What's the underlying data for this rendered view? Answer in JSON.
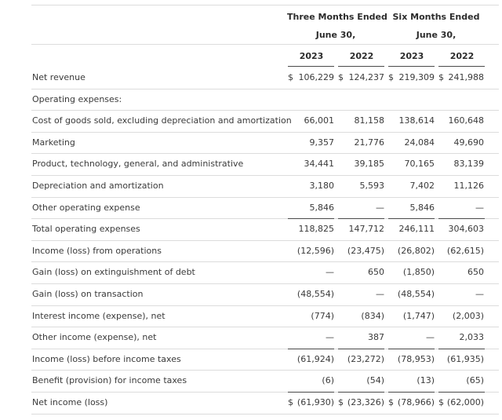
{
  "header": {
    "three_months": "Three Months Ended",
    "three_months_sub": "June 30,",
    "six_months": "Six Months Ended",
    "six_months_sub": "June 30,",
    "years": [
      "2023",
      "2022",
      "2023",
      "2022"
    ]
  },
  "rows": [
    {
      "label": "Net revenue",
      "values": [
        "106,229",
        "124,237",
        "219,309",
        "241,988"
      ],
      "dollars": [
        "$",
        "$",
        "$",
        "$"
      ]
    },
    {
      "label": "Operating expenses:",
      "values": [
        "",
        "",
        "",
        ""
      ],
      "dollars": [
        "",
        "",
        "",
        ""
      ]
    },
    {
      "label": "Cost of goods sold, excluding depreciation and amortization",
      "values": [
        "66,001",
        "81,158",
        "138,614",
        "160,648"
      ],
      "dollars": [
        "",
        "",
        "",
        ""
      ]
    },
    {
      "label": "Marketing",
      "values": [
        "9,357",
        "21,776",
        "24,084",
        "49,690"
      ],
      "dollars": [
        "",
        "",
        "",
        ""
      ]
    },
    {
      "label": "Product, technology, general, and administrative",
      "values": [
        "34,441",
        "39,185",
        "70,165",
        "83,139"
      ],
      "dollars": [
        "",
        "",
        "",
        ""
      ]
    },
    {
      "label": "Depreciation and amortization",
      "values": [
        "3,180",
        "5,593",
        "7,402",
        "11,126"
      ],
      "dollars": [
        "",
        "",
        "",
        ""
      ]
    },
    {
      "label": "Other operating expense",
      "values": [
        "5,846",
        "—",
        "5,846",
        "—"
      ],
      "dollars": [
        "",
        "",
        "",
        ""
      ]
    },
    {
      "label": "Total operating expenses",
      "values": [
        "118,825",
        "147,712",
        "246,111",
        "304,603"
      ],
      "dollars": [
        "",
        "",
        "",
        ""
      ]
    },
    {
      "label": "Income (loss) from operations",
      "values": [
        "(12,596)",
        "(23,475)",
        "(26,802)",
        "(62,615)"
      ],
      "dollars": [
        "",
        "",
        "",
        ""
      ]
    },
    {
      "label": "Gain (loss) on extinguishment of debt",
      "values": [
        "—",
        "650",
        "(1,850)",
        "650"
      ],
      "dollars": [
        "",
        "",
        "",
        ""
      ]
    },
    {
      "label": "Gain (loss) on transaction",
      "values": [
        "(48,554)",
        "—",
        "(48,554)",
        "—"
      ],
      "dollars": [
        "",
        "",
        "",
        ""
      ]
    },
    {
      "label": "Interest income (expense), net",
      "values": [
        "(774)",
        "(834)",
        "(1,747)",
        "(2,003)"
      ],
      "dollars": [
        "",
        "",
        "",
        ""
      ]
    },
    {
      "label": "Other income (expense), net",
      "values": [
        "—",
        "387",
        "—",
        "2,033"
      ],
      "dollars": [
        "",
        "",
        "",
        ""
      ]
    },
    {
      "label": "Income (loss) before income taxes",
      "values": [
        "(61,924)",
        "(23,272)",
        "(78,953)",
        "(61,935)"
      ],
      "dollars": [
        "",
        "",
        "",
        ""
      ]
    },
    {
      "label": "Benefit (provision) for income taxes",
      "values": [
        "(6)",
        "(54)",
        "(13)",
        "(65)"
      ],
      "dollars": [
        "",
        "",
        "",
        ""
      ]
    },
    {
      "label": "Net income (loss)",
      "values": [
        "(61,930)",
        "(23,326)",
        "(78,966)",
        "(62,000)"
      ],
      "dollars": [
        "$",
        "$",
        "$",
        "$"
      ]
    }
  ]
}
